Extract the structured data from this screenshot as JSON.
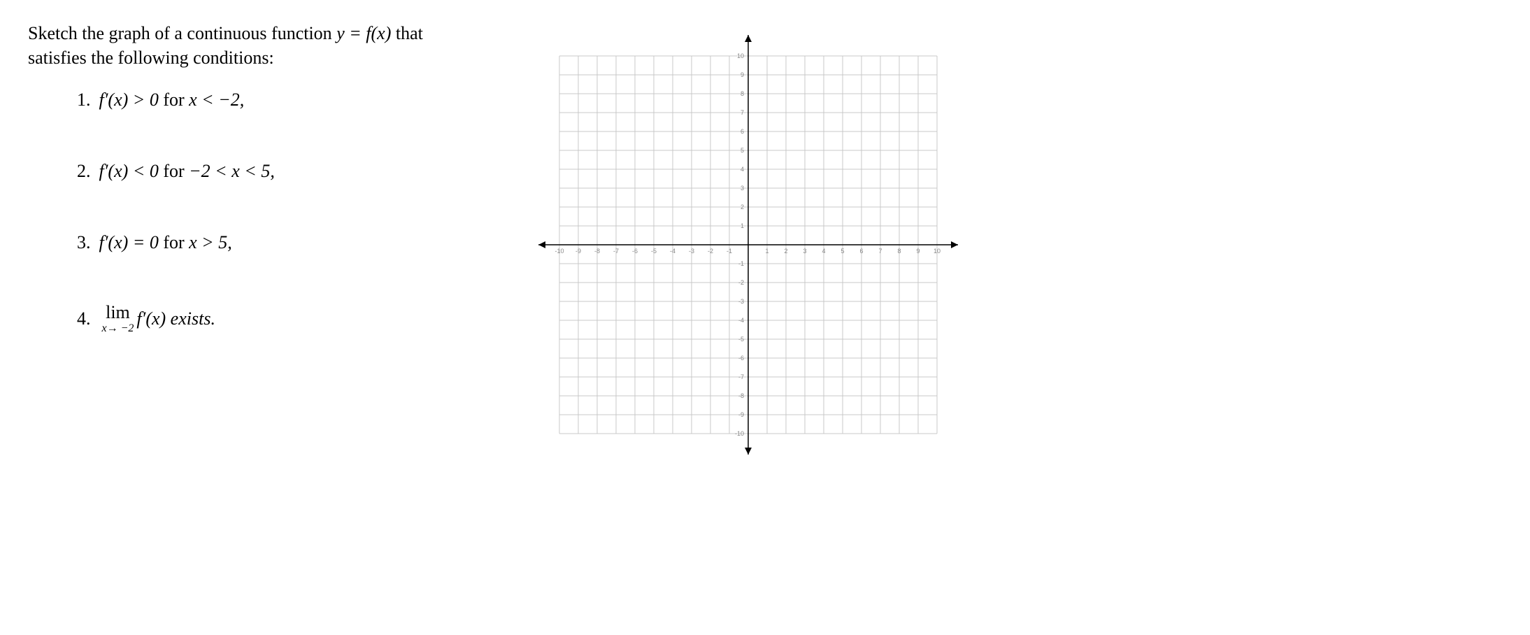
{
  "prompt": {
    "line1_pre": "Sketch the graph of a continuous function  ",
    "line1_math": "y = f(x)",
    "line1_post": "  that",
    "line2": "satisfies the following conditions:"
  },
  "conditions": [
    {
      "num": "1.",
      "lhs": "f′(x) > 0",
      "mid": "  for  ",
      "rhs": "x < −2,",
      "type": "inline"
    },
    {
      "num": "2.",
      "lhs": "f′(x) < 0",
      "mid": "  for  ",
      "rhs": "−2 < x < 5,",
      "type": "inline"
    },
    {
      "num": "3.",
      "lhs": "f′(x) = 0",
      "mid": "  for  ",
      "rhs": "x > 5,",
      "type": "inline"
    },
    {
      "num": "4.",
      "limtop": "lim",
      "limbot": "x→ −2",
      "after": " f′(x) exists.",
      "type": "limit"
    }
  ],
  "chart_data": {
    "type": "grid",
    "title": "",
    "xlabel": "",
    "ylabel": "",
    "xlim": [
      -10,
      10
    ],
    "ylim": [
      -10,
      10
    ],
    "xticks": [
      -10,
      -9,
      -8,
      -7,
      -6,
      -5,
      -4,
      -3,
      -2,
      -1,
      1,
      2,
      3,
      4,
      5,
      6,
      7,
      8,
      9,
      10
    ],
    "yticks": [
      -10,
      -9,
      -8,
      -7,
      -6,
      -5,
      -4,
      -3,
      -2,
      -1,
      1,
      2,
      3,
      4,
      5,
      6,
      7,
      8,
      9,
      10
    ],
    "grid": true,
    "series": []
  }
}
